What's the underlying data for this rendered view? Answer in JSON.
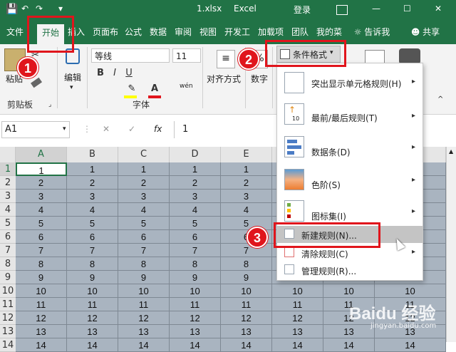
{
  "title_bar": {
    "filename": "1.xlsx",
    "app": "Excel",
    "login": "登录",
    "ribbon_options_icon": "ribbon-display-icon",
    "min": "—",
    "max": "☐",
    "close": "✕"
  },
  "tabs": [
    {
      "label": "文件"
    },
    {
      "label": "开始"
    },
    {
      "label": "插入"
    },
    {
      "label": "页面布"
    },
    {
      "label": "公式"
    },
    {
      "label": "数据"
    },
    {
      "label": "审阅"
    },
    {
      "label": "视图"
    },
    {
      "label": "开发工"
    },
    {
      "label": "加载项"
    },
    {
      "label": "团队"
    },
    {
      "label": "我的菜"
    }
  ],
  "tellme": "告诉我",
  "share": "共享",
  "ribbon": {
    "paste": "粘贴",
    "clipboard": "剪贴板",
    "edit": "编辑",
    "font_name": "等线",
    "font_size": "11",
    "bold": "B",
    "italic": "I",
    "underline": "U",
    "font_group": "字体",
    "wen": "wén",
    "align": "对齐方式",
    "number": "数字",
    "cond_format": "条件格式"
  },
  "formula_bar": {
    "namebox": "A1",
    "cancel": "✕",
    "enter": "✓",
    "fx": "fx",
    "value": "1"
  },
  "columns": [
    "A",
    "B",
    "C",
    "D",
    "E"
  ],
  "rows": [
    "1",
    "2",
    "3",
    "4",
    "5",
    "6",
    "7",
    "8",
    "9",
    "10",
    "11",
    "12",
    "13",
    "14"
  ],
  "extra_col_values": [
    "10",
    "11",
    "12",
    "13"
  ],
  "menu": {
    "items": [
      {
        "label": "突出显示单元格规则(H)"
      },
      {
        "label": "最前/最后规则(T)"
      },
      {
        "label": "数据条(D)"
      },
      {
        "label": "色阶(S)"
      },
      {
        "label": "图标集(I)"
      },
      {
        "label": "新建规则(N)..."
      },
      {
        "label": "清除规则(C)"
      },
      {
        "label": "管理规则(R)..."
      }
    ],
    "icon_number": "10"
  },
  "badges": [
    "1",
    "2",
    "3"
  ],
  "watermark": "Baidu 经验",
  "watermark_url": "jingyan.baidu.com",
  "colors": {
    "excel_green": "#217346",
    "selection": "#a9b4c0",
    "callout_red": "#e0151c"
  }
}
